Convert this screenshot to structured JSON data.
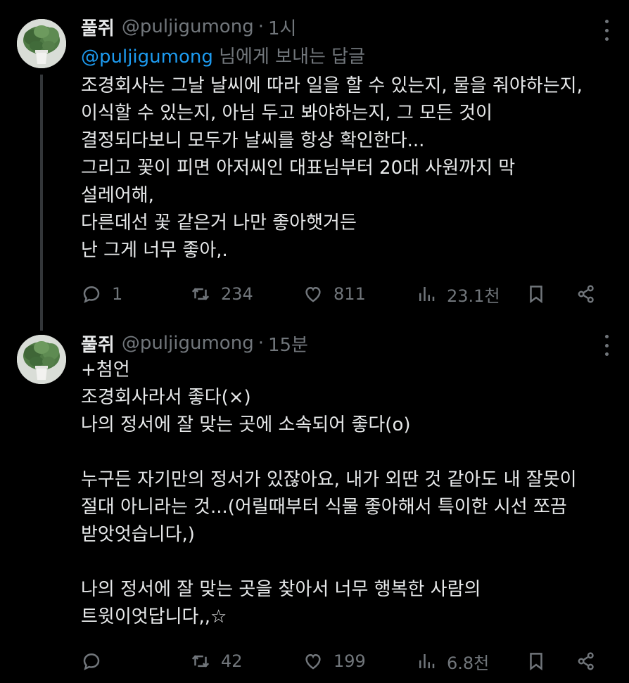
{
  "tweets": [
    {
      "author_name": "풀쥐",
      "author_handle": "@puljigumong",
      "separator": "·",
      "time": "1시",
      "reply_mention": "@puljigumong",
      "reply_suffix": " 님에게 보내는 답글",
      "lines": [
        "조경회사는 그날 날씨에 따라 일을 할 수 있는지, 물을 줘야하는지,",
        "이식할 수 있는지, 아님 두고 봐야하는지, 그 모든 것이",
        "결정되다보니 모두가 날씨를 항상 확인한다...",
        "그리고 꽃이 피면 아저씨인 대표님부터 20대 사원까지 막",
        "설레어해,",
        "다른데선 꽃 같은거 나만 좋아햇거든",
        "난 그게 너무 좋아,."
      ],
      "replies": "1",
      "retweets": "234",
      "likes": "811",
      "views": "23.1천"
    },
    {
      "author_name": "풀쥐",
      "author_handle": "@puljigumong",
      "separator": "·",
      "time": "15분",
      "lines": [
        "+첨언",
        "조경회사라서 좋다(×)",
        "나의 정서에 잘 맞는 곳에 소속되어 좋다(o)",
        "",
        "누구든 자기만의 정서가 있잖아요, 내가 외딴 것 같아도 내 잘못이",
        "절대 아니라는 것...(어릴때부터 식물 좋아해서 특이한 시선 쪼끔",
        "받앗엇습니다,)",
        "",
        "나의 정서에 잘 맞는 곳을 찾아서 너무 행복한 사람의",
        "트윗이엇답니다,,☆"
      ],
      "replies": "",
      "retweets": "42",
      "likes": "199",
      "views": "6.8천"
    }
  ],
  "icons": {
    "reply": "reply-icon",
    "retweet": "retweet-icon",
    "like": "heart-icon",
    "views": "views-chart-icon",
    "bookmark": "bookmark-icon",
    "share": "share-icon",
    "more": "more-dots-icon"
  },
  "colors": {
    "background": "#000000",
    "text": "#e7e9ea",
    "secondary": "#71767b",
    "mention": "#1d9bf0",
    "thread_line": "#333639"
  }
}
